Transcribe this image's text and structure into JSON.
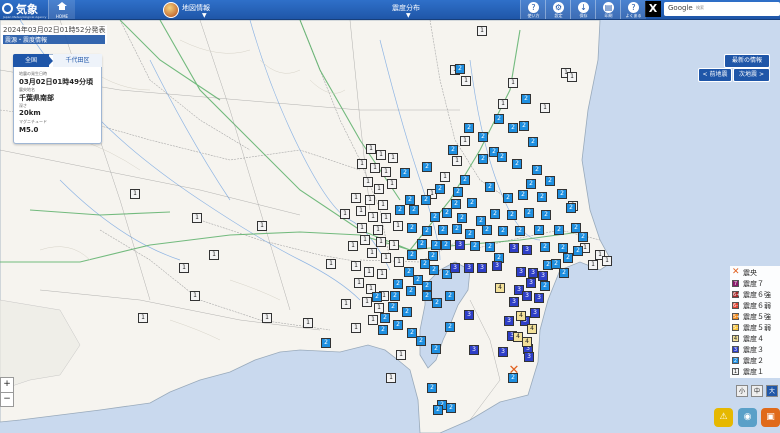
{
  "header": {
    "logo_text": "気象庁",
    "logo_sub": "Japan Meteorological Agency",
    "home_label": "HOME",
    "map_menu": "地図情報",
    "dist_menu": "震度分布",
    "tools": [
      {
        "icon": "help-icon",
        "glyph": "?",
        "label": "使い方"
      },
      {
        "icon": "settings-icon",
        "glyph": "⚙",
        "label": "設定"
      },
      {
        "icon": "download-icon",
        "glyph": "↓",
        "label": "保存"
      },
      {
        "icon": "print-icon",
        "glyph": "▤",
        "label": "印刷"
      },
      {
        "icon": "question-icon",
        "glyph": "?",
        "label": "よくある"
      }
    ],
    "x_label": "X",
    "search_brand": "Google",
    "search_placeholder": "検索"
  },
  "announcement": {
    "title": "2024年03月02日01時52分発表",
    "subtitle": "震源・震度情報"
  },
  "info_panel": {
    "breadcrumb_all": "全国",
    "breadcrumb_area": "千代田区",
    "time_label": "地震の発生日時",
    "time_value": "03月02日01時49分頃",
    "epicenter_label": "震央地名",
    "epicenter_value": "千葉県南部",
    "depth_label": "深さ",
    "depth_value": "20km",
    "magnitude_label": "マグニチュード",
    "magnitude_value": "M5.0"
  },
  "nav": {
    "latest": "最新の情報",
    "prev": "< 前地震",
    "next": "次地震 >"
  },
  "legend": [
    {
      "label": "震央",
      "kind": "epicenter",
      "color": "#e0601f"
    },
    {
      "label": "震度７",
      "code": "7",
      "color": "#8a1a6b"
    },
    {
      "label": "震度６強",
      "code": "6+",
      "color": "#a52a2a"
    },
    {
      "label": "震度６弱",
      "code": "6-",
      "color": "#e0402e"
    },
    {
      "label": "震度５強",
      "code": "5+",
      "color": "#f08a1e"
    },
    {
      "label": "震度５弱",
      "code": "5-",
      "color": "#f6c33b"
    },
    {
      "label": "震度４",
      "code": "4",
      "color": "#f3e19a"
    },
    {
      "label": "震度３",
      "code": "3",
      "color": "#2e3fc8"
    },
    {
      "label": "震度２",
      "code": "2",
      "color": "#1e8fe0"
    },
    {
      "label": "震度１",
      "code": "1",
      "color": "#f4f4f4"
    }
  ],
  "size_controls": [
    "小",
    "中",
    "大"
  ],
  "zoom": {
    "in": "+",
    "out": "−"
  },
  "markers": {
    "i4": [
      [
        500,
        288
      ],
      [
        521,
        316
      ],
      [
        532,
        329
      ],
      [
        518,
        337
      ],
      [
        527,
        342
      ]
    ],
    "i3": [
      [
        460,
        245
      ],
      [
        514,
        248
      ],
      [
        527,
        250
      ],
      [
        455,
        268
      ],
      [
        469,
        268
      ],
      [
        482,
        268
      ],
      [
        497,
        266
      ],
      [
        521,
        272
      ],
      [
        533,
        273
      ],
      [
        543,
        276
      ],
      [
        531,
        283
      ],
      [
        519,
        290
      ],
      [
        527,
        296
      ],
      [
        514,
        302
      ],
      [
        539,
        298
      ],
      [
        535,
        313
      ],
      [
        509,
        321
      ],
      [
        525,
        321
      ],
      [
        469,
        315
      ],
      [
        512,
        336
      ],
      [
        503,
        352
      ],
      [
        528,
        349
      ],
      [
        529,
        357
      ],
      [
        474,
        350
      ]
    ],
    "i2": [
      [
        460,
        69
      ],
      [
        526,
        99
      ],
      [
        469,
        128
      ],
      [
        499,
        119
      ],
      [
        513,
        128
      ],
      [
        524,
        126
      ],
      [
        483,
        137
      ],
      [
        533,
        142
      ],
      [
        453,
        150
      ],
      [
        494,
        152
      ],
      [
        483,
        159
      ],
      [
        502,
        157
      ],
      [
        517,
        164
      ],
      [
        537,
        170
      ],
      [
        427,
        167
      ],
      [
        405,
        173
      ],
      [
        465,
        180
      ],
      [
        490,
        187
      ],
      [
        531,
        184
      ],
      [
        550,
        181
      ],
      [
        440,
        189
      ],
      [
        458,
        192
      ],
      [
        410,
        200
      ],
      [
        426,
        200
      ],
      [
        400,
        210
      ],
      [
        414,
        210
      ],
      [
        456,
        204
      ],
      [
        472,
        203
      ],
      [
        508,
        198
      ],
      [
        523,
        195
      ],
      [
        542,
        197
      ],
      [
        562,
        194
      ],
      [
        435,
        217
      ],
      [
        447,
        213
      ],
      [
        462,
        218
      ],
      [
        481,
        221
      ],
      [
        495,
        214
      ],
      [
        512,
        215
      ],
      [
        529,
        213
      ],
      [
        546,
        215
      ],
      [
        571,
        208
      ],
      [
        412,
        228
      ],
      [
        427,
        231
      ],
      [
        443,
        230
      ],
      [
        457,
        229
      ],
      [
        470,
        234
      ],
      [
        487,
        230
      ],
      [
        503,
        231
      ],
      [
        520,
        231
      ],
      [
        539,
        230
      ],
      [
        559,
        230
      ],
      [
        576,
        228
      ],
      [
        583,
        237
      ],
      [
        422,
        244
      ],
      [
        436,
        245
      ],
      [
        446,
        245
      ],
      [
        475,
        246
      ],
      [
        490,
        247
      ],
      [
        499,
        258
      ],
      [
        545,
        247
      ],
      [
        563,
        248
      ],
      [
        578,
        251
      ],
      [
        433,
        256
      ],
      [
        412,
        255
      ],
      [
        425,
        264
      ],
      [
        434,
        270
      ],
      [
        447,
        274
      ],
      [
        409,
        272
      ],
      [
        418,
        280
      ],
      [
        427,
        286
      ],
      [
        398,
        284
      ],
      [
        411,
        291
      ],
      [
        395,
        296
      ],
      [
        377,
        297
      ],
      [
        393,
        307
      ],
      [
        407,
        312
      ],
      [
        427,
        296
      ],
      [
        437,
        303
      ],
      [
        450,
        296
      ],
      [
        548,
        265
      ],
      [
        556,
        264
      ],
      [
        568,
        258
      ],
      [
        385,
        318
      ],
      [
        398,
        325
      ],
      [
        383,
        330
      ],
      [
        412,
        333
      ],
      [
        421,
        341
      ],
      [
        326,
        343
      ],
      [
        450,
        327
      ],
      [
        436,
        349
      ],
      [
        545,
        286
      ],
      [
        564,
        273
      ],
      [
        432,
        388
      ],
      [
        442,
        405
      ],
      [
        451,
        408
      ],
      [
        438,
        410
      ],
      [
        513,
        378
      ]
    ],
    "i1": [
      [
        371,
        149
      ],
      [
        381,
        155
      ],
      [
        393,
        158
      ],
      [
        362,
        164
      ],
      [
        375,
        168
      ],
      [
        386,
        172
      ],
      [
        368,
        182
      ],
      [
        379,
        189
      ],
      [
        392,
        184
      ],
      [
        356,
        198
      ],
      [
        370,
        200
      ],
      [
        383,
        205
      ],
      [
        361,
        211
      ],
      [
        373,
        217
      ],
      [
        345,
        214
      ],
      [
        386,
        218
      ],
      [
        398,
        226
      ],
      [
        362,
        228
      ],
      [
        378,
        230
      ],
      [
        365,
        240
      ],
      [
        381,
        242
      ],
      [
        394,
        245
      ],
      [
        372,
        253
      ],
      [
        386,
        258
      ],
      [
        399,
        262
      ],
      [
        356,
        266
      ],
      [
        369,
        272
      ],
      [
        382,
        274
      ],
      [
        359,
        283
      ],
      [
        371,
        289
      ],
      [
        384,
        296
      ],
      [
        367,
        302
      ],
      [
        379,
        308
      ],
      [
        346,
        304
      ],
      [
        373,
        320
      ],
      [
        401,
        355
      ],
      [
        391,
        378
      ],
      [
        356,
        328
      ],
      [
        308,
        323
      ],
      [
        267,
        318
      ],
      [
        331,
        264
      ],
      [
        353,
        246
      ],
      [
        135,
        194
      ],
      [
        197,
        218
      ],
      [
        262,
        226
      ],
      [
        195,
        296
      ],
      [
        143,
        318
      ],
      [
        184,
        268
      ],
      [
        214,
        255
      ],
      [
        566,
        73
      ],
      [
        572,
        77
      ],
      [
        513,
        83
      ],
      [
        466,
        81
      ],
      [
        482,
        31
      ],
      [
        503,
        104
      ],
      [
        545,
        108
      ],
      [
        573,
        206
      ],
      [
        585,
        248
      ],
      [
        600,
        255
      ],
      [
        593,
        265
      ],
      [
        607,
        261
      ],
      [
        455,
        70
      ],
      [
        432,
        194
      ],
      [
        445,
        177
      ],
      [
        465,
        141
      ],
      [
        457,
        161
      ]
    ]
  }
}
